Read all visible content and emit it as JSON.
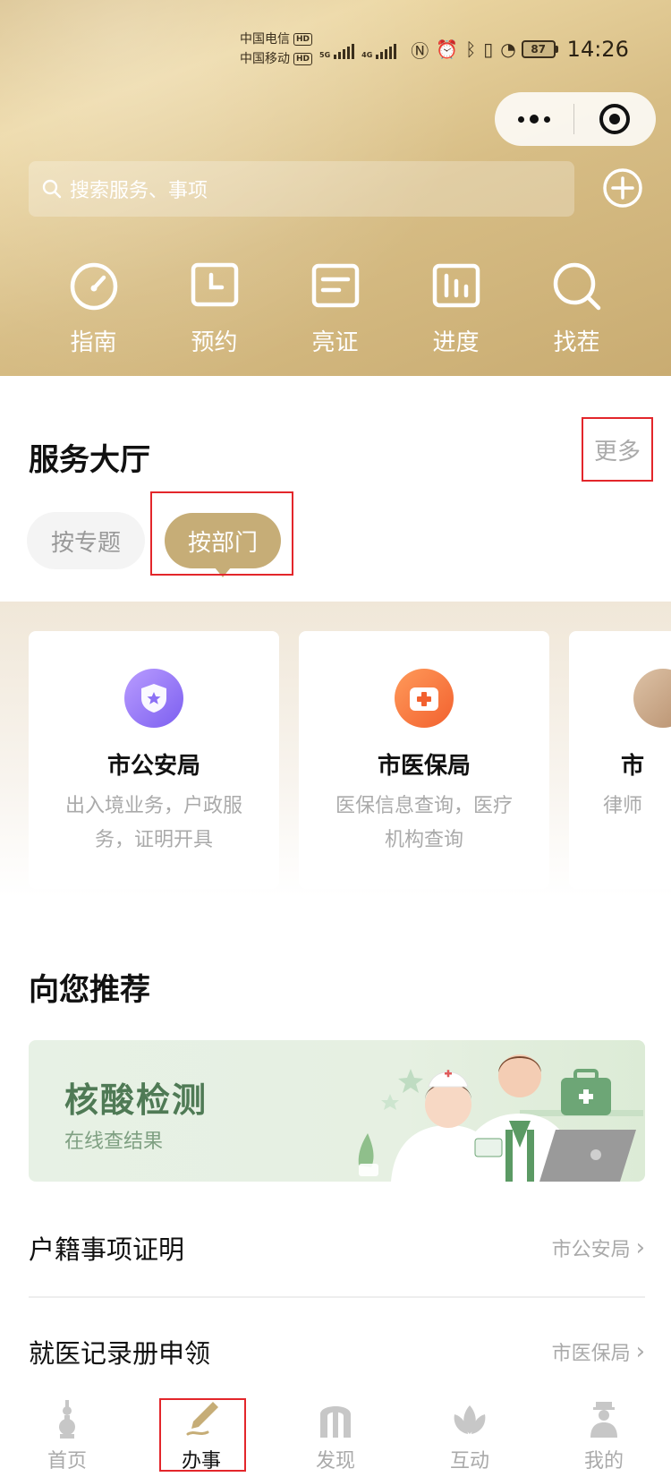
{
  "status_bar": {
    "carriers": [
      "中国电信",
      "中国移动"
    ],
    "hd_badge": "HD",
    "network_tags": [
      "5G",
      "4G"
    ],
    "battery": "87",
    "time": "14:26"
  },
  "search": {
    "placeholder": "搜索服务、事项"
  },
  "quick_actions": [
    {
      "label": "指南",
      "icon": "gauge-icon"
    },
    {
      "label": "预约",
      "icon": "clock-icon"
    },
    {
      "label": "亮证",
      "icon": "id-card-icon"
    },
    {
      "label": "进度",
      "icon": "bar-chart-icon"
    },
    {
      "label": "找茬",
      "icon": "magnifier-icon"
    }
  ],
  "service_hall": {
    "title": "服务大厅",
    "more": "更多",
    "tabs": [
      "按专题",
      "按部门"
    ],
    "active_tab": "按部门",
    "departments": [
      {
        "name": "市公安局",
        "desc": "出入境业务，户政服务，证明开具",
        "icon": "police-shield-icon"
      },
      {
        "name": "市医保局",
        "desc": "医保信息查询，医疗机构查询",
        "icon": "medical-cross-icon"
      },
      {
        "name": "市",
        "desc": "律师",
        "icon": "lawyer-icon"
      }
    ]
  },
  "recommend": {
    "title": "向您推荐",
    "banner_title": "核酸检测",
    "banner_sub": "在线查结果",
    "items": [
      {
        "title": "户籍事项证明",
        "dept": "市公安局"
      },
      {
        "title": "就医记录册申领",
        "dept": "市医保局"
      }
    ]
  },
  "tabbar": {
    "items": [
      {
        "label": "首页",
        "icon": "tower-icon"
      },
      {
        "label": "办事",
        "icon": "pen-icon"
      },
      {
        "label": "发现",
        "icon": "arch-icon"
      },
      {
        "label": "互动",
        "icon": "lotus-icon"
      },
      {
        "label": "我的",
        "icon": "person-icon"
      }
    ],
    "active": "办事"
  },
  "colors": {
    "accent": "#c6ad77",
    "highlight_box": "#e3262b",
    "police_icon": "#7c5ff0",
    "medical_icon": "#f2612f",
    "banner_green": "#4f7a55"
  }
}
